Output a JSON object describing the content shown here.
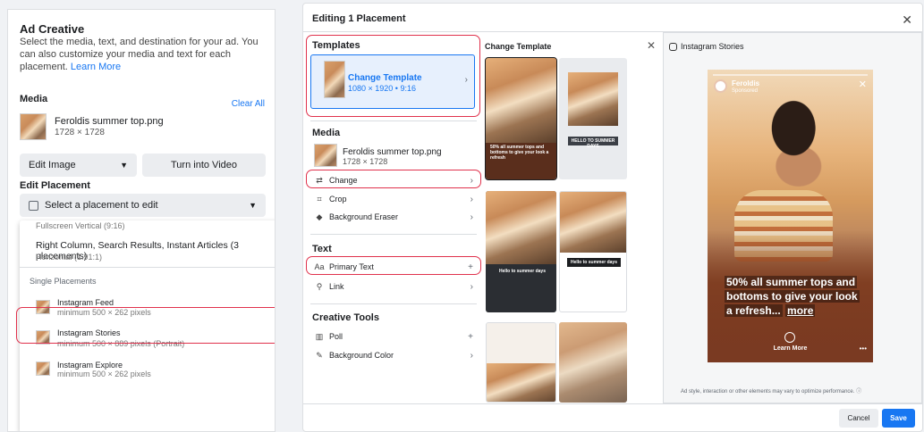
{
  "ad_creative": {
    "title": "Ad Creative",
    "description": "Select the media, text, and destination for your ad. You can also customize your media and text for each placement.",
    "learn_more": "Learn More",
    "media_heading": "Media",
    "clear_all": "Clear All",
    "file_name": "Feroldis summer top.png",
    "file_dims": "1728 × 1728",
    "edit_image": "Edit Image",
    "turn_into_video": "Turn into Video",
    "edit_placement_heading": "Edit Placement",
    "select_placement": "Select a placement to edit",
    "dropdown": {
      "fullscreen_vertical": "Fullscreen Vertical (9:16)",
      "right_column_title": "Right Column, Search Results, Instant Articles (3 placements)",
      "right_column_sub": "Horizontal (1.91:1)",
      "single_placements": "Single Placements",
      "items": [
        {
          "title": "Instagram Feed",
          "sub": "minimum 500 × 262 pixels"
        },
        {
          "title": "Instagram Stories",
          "sub": "minimum 500 × 889 pixels (Portrait)"
        },
        {
          "title": "Instagram Explore",
          "sub": "minimum 500 × 262 pixels"
        }
      ]
    }
  },
  "modal": {
    "title": "Editing 1 Placement",
    "close_icon": "close-icon",
    "templates_heading": "Templates",
    "change_template": "Change Template",
    "template_dims": "1080 × 1920 • 9:16",
    "media_heading": "Media",
    "file_name": "Feroldis summer top.png",
    "file_dims": "1728 × 1728",
    "media_options": [
      {
        "icon": "⇄",
        "label": "Change"
      },
      {
        "icon": "⌗",
        "label": "Crop"
      },
      {
        "icon": "◆",
        "label": "Background Eraser"
      }
    ],
    "text_heading": "Text",
    "text_options": [
      {
        "icon": "Aa",
        "label": "Primary Text",
        "action": "+"
      },
      {
        "icon": "⚲",
        "label": "Link",
        "action": "›"
      }
    ],
    "creative_tools_heading": "Creative Tools",
    "creative_tools": [
      {
        "icon": "▥",
        "label": "Poll",
        "action": "+"
      },
      {
        "icon": "✎",
        "label": "Background Color",
        "action": "›"
      }
    ],
    "change_template_heading": "Change Template",
    "template_captions": [
      "50% all summer tops and bottoms to give your look a refresh",
      "HELLO TO SUMMER DAYS",
      "Hello to summer days",
      "Hello to summer days"
    ],
    "preview_heading": "Instagram Stories",
    "story": {
      "brand": "Feroldis",
      "sponsored": "Sponsored",
      "caption": "50% all summer tops and bottoms to give your look a refresh...",
      "more": "more",
      "learn_more": "Learn More",
      "dots": "•••"
    },
    "disclaimer": "Ad style, interaction or other elements may vary to optimize performance.",
    "cancel": "Cancel",
    "save": "Save"
  }
}
